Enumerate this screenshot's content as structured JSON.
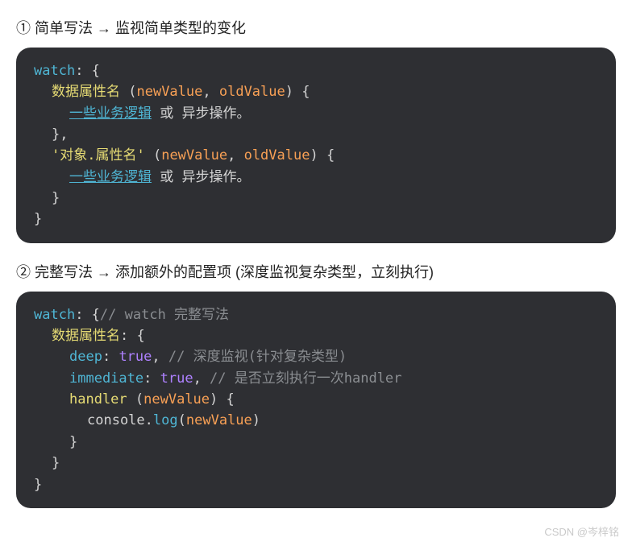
{
  "section1": {
    "title": "① 简单写法 → 监视简单类型的变化",
    "code": {
      "watch": "watch",
      "colon": ": ",
      "lbrace": "{",
      "rbrace": "}",
      "prop1": "数据属性名",
      "lparen": " (",
      "newValue": "newValue",
      "comma": ", ",
      "oldValue": "oldValue",
      "rparen_lbrace": ") {",
      "logic_u": "一些业务逻辑",
      "logic_mid": " 或 ",
      "logic_async": "异步操作",
      "period": "。",
      "rbrace_comma": "},",
      "prop2": "'对象.属性名'"
    }
  },
  "section2": {
    "title": "② 完整写法 → 添加额外的配置项 (深度监视复杂类型，立刻执行)",
    "code": {
      "watch": "watch",
      "colon": ": ",
      "lbrace": "{",
      "comment1": "// watch 完整写法",
      "prop": "数据属性名",
      "prop_colon_brace": ": {",
      "deep": "deep",
      "true": "true",
      "comma": ", ",
      "commaspace": ",",
      "comment2": " // 深度监视(针对复杂类型)",
      "immediate": "immediate",
      "comment3": " // 是否立刻执行一次handler",
      "handler": "handler",
      "lparen": " (",
      "newValue": "newValue",
      "rparen_lbrace": ") {",
      "console": "console",
      "dot": ".",
      "log": "log",
      "log_lparen": "(",
      "log_rparen": ")",
      "rbrace": "}"
    }
  },
  "watermark": "CSDN @岑梓铭"
}
